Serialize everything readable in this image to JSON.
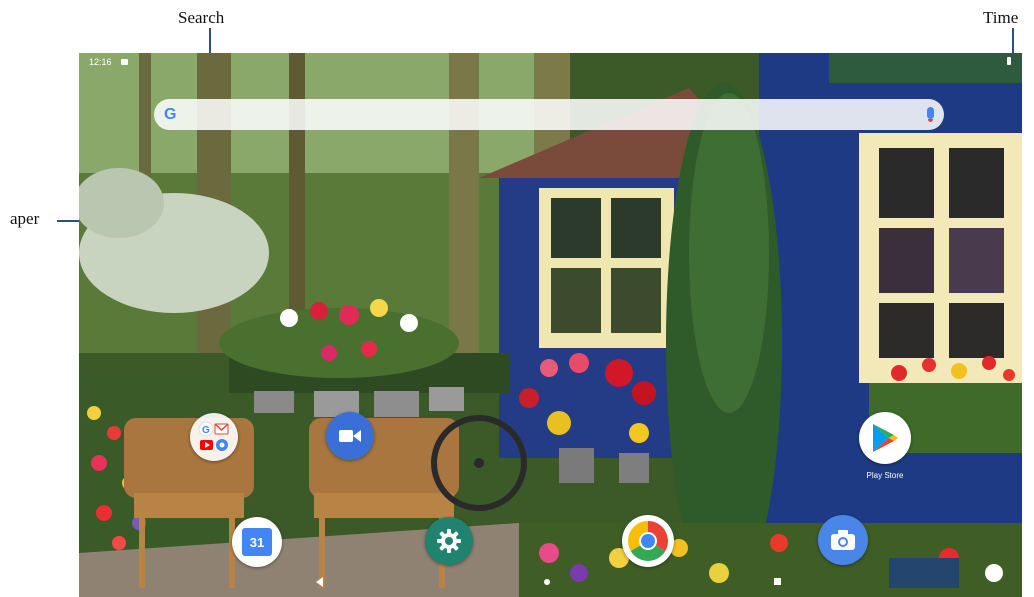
{
  "callouts": {
    "search": "Search",
    "time": "Time",
    "wallpaper": "aper"
  },
  "status_bar": {
    "time": "12:16"
  },
  "search_bar": {
    "logo": "G",
    "logo_icon": "google-g-icon",
    "mic_icon": "mic-icon"
  },
  "apps": [
    {
      "name": "google-apps-folder",
      "icon": "folder-icon",
      "label": ""
    },
    {
      "name": "duo",
      "icon": "video-camera-icon",
      "label": ""
    },
    {
      "name": "play-store",
      "icon": "play-store-icon",
      "label": "Play Store"
    },
    {
      "name": "calendar",
      "icon": "calendar-icon",
      "label": "31"
    },
    {
      "name": "settings",
      "icon": "gear-icon",
      "label": ""
    },
    {
      "name": "chrome",
      "icon": "chrome-icon",
      "label": ""
    },
    {
      "name": "camera",
      "icon": "camera-icon",
      "label": ""
    }
  ],
  "colors": {
    "accent_blue": "#4285f4",
    "settings_green": "#20836f",
    "house_blue": "#243c86"
  }
}
